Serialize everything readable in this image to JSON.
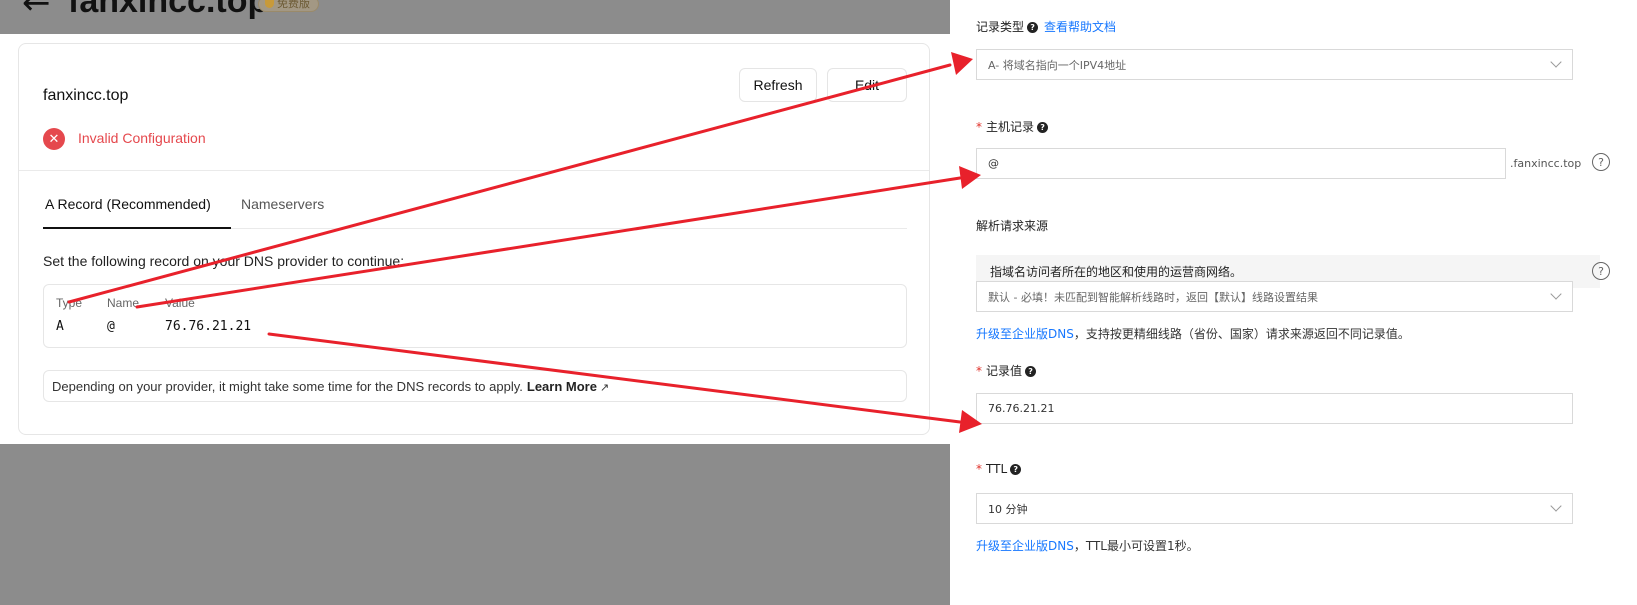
{
  "header": {
    "back_icon": "arrow-left-icon",
    "domain_title": "fanxincc.top",
    "plan_badge": "免费版"
  },
  "vercel": {
    "domain": "fanxincc.top",
    "refresh_label": "Refresh",
    "edit_label": "Edit",
    "status_icon": "x-circle-icon",
    "status": "Invalid Configuration",
    "tabs": [
      {
        "label": "A Record (Recommended)",
        "active": true
      },
      {
        "label": "Nameservers",
        "active": false
      }
    ],
    "instruction": "Set the following record on your DNS provider to continue:",
    "record": {
      "headers": [
        "Type",
        "Name",
        "Value"
      ],
      "values": [
        "A",
        "@",
        "76.76.21.21"
      ]
    },
    "note": "Depending on your provider, it might take some time for the DNS records to apply.",
    "learn_more": "Learn More"
  },
  "aliyun": {
    "record_type_label": "记录类型",
    "help_doc_link": "查看帮助文档",
    "record_type_value": "A- 将域名指向一个IPV4地址",
    "host_label": "主机记录",
    "host_value": "@",
    "host_suffix": ".fanxincc.top",
    "line_label": "解析请求来源",
    "line_info": "指域名访问者所在的地区和使用的运营商网络。",
    "line_value": "默认 - 必填！未匹配到智能解析线路时，返回【默认】线路设置结果",
    "line_upgrade_link": "升级至企业版DNS",
    "line_upgrade_text": "，支持按更精细线路（省份、国家）请求来源返回不同记录值。",
    "value_label": "记录值",
    "value_value": "76.76.21.21",
    "ttl_label": "TTL",
    "ttl_value": "10 分钟",
    "ttl_upgrade_link": "升级至企业版DNS",
    "ttl_upgrade_text": "，TTL最小可设置1秒。"
  },
  "colors": {
    "arrow": "#e8212b",
    "error": "#e5484d",
    "link": "#1677ff",
    "overlay": "#8c8c8c"
  }
}
